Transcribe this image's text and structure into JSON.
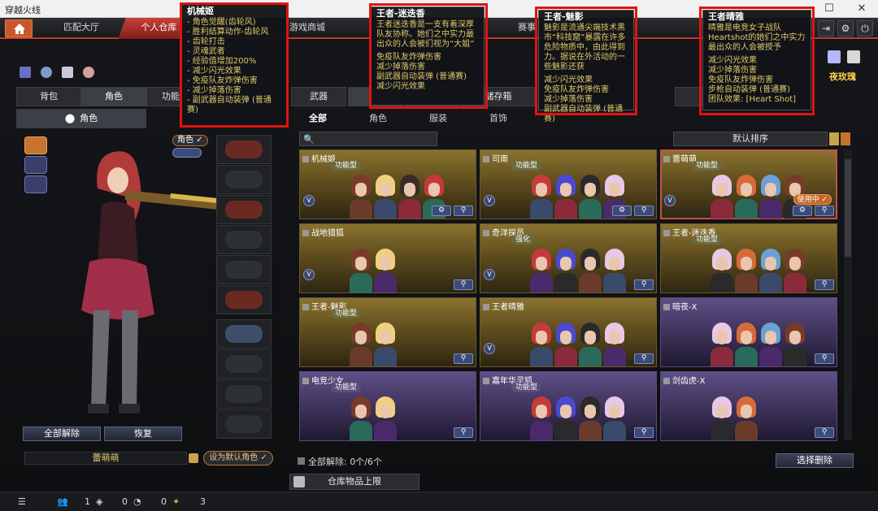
{
  "window": {
    "title": "穿越火线"
  },
  "nav": {
    "tabs": [
      "匹配大厅",
      "个人仓库",
      "游戏商城",
      "赛事"
    ],
    "active": "个人仓库"
  },
  "left": {
    "tabs": [
      "背包",
      "角色",
      "功能"
    ],
    "subtab": "角色",
    "role_badge": "角色 ✓",
    "buttons": {
      "unequip_all": "全部解除",
      "restore": "恢复"
    },
    "char_name": "蕾萌萌",
    "set_default": "设为默认角色 ✓"
  },
  "right": {
    "tabs": [
      "武器",
      "",
      "",
      "储存箱",
      ""
    ],
    "subtabs": [
      "全部",
      "角色",
      "服装",
      "首饰"
    ],
    "search_placeholder": "",
    "sort_label": "默认排序",
    "footer": {
      "unequip_count": "全部解除: 0个/6个",
      "select_delete": "选择删除",
      "storage_limit": "仓库物品上限"
    }
  },
  "cards": [
    {
      "title": "机械姬",
      "badge": "功能型",
      "style": "gold"
    },
    {
      "title": "司南",
      "badge": "功能型",
      "style": "gold"
    },
    {
      "title": "蕾萌萌",
      "badge": "功能型",
      "style": "gold",
      "in_use": "使用中 ✓"
    },
    {
      "title": "战地猎狐",
      "badge": "",
      "style": "gold"
    },
    {
      "title": "奇洋探员",
      "badge": "强化",
      "style": "gold"
    },
    {
      "title": "王者-迷迭香",
      "badge": "功能型",
      "style": "gold"
    },
    {
      "title": "王者-魅影",
      "badge": "功能型",
      "style": "gold"
    },
    {
      "title": "王者晴雅",
      "badge": "",
      "style": "gold"
    },
    {
      "title": "暗夜-X",
      "badge": "",
      "style": "purple"
    },
    {
      "title": "电竞少女",
      "badge": "功能型",
      "style": "purple"
    },
    {
      "title": "嘉年华灵狐",
      "badge": "功能型",
      "style": "purple"
    },
    {
      "title": "剑齿虎-X",
      "badge": "",
      "style": "purple"
    }
  ],
  "popups": {
    "p1": {
      "title": "机械姬",
      "lines": [
        "- 角色觉醒(齿轮风)",
        "- 胜利结算动作-齿轮风",
        "- 齿轮打击",
        "- 灵魂武者",
        "- 经验值增加200%",
        "- 减少闪光效果",
        "- 免疫队友炸弹伤害",
        "- 减少掉落伤害",
        "- 副武器自动装弹 (普通赛)"
      ]
    },
    "p2": {
      "title": "王者-迷迭香",
      "desc": "王者迷迭香是一支有着深厚队友协称。她们之中实力最出众的人会被们视为“大姐”",
      "lines": [
        "免疫队友炸弹伤害",
        "减少掉落伤害",
        "副武器自动装弹 (普通赛)",
        "减少闪光效果"
      ]
    },
    "p3": {
      "title": "王者-魅影",
      "desc": "魅影是流通尖端技术黑市“科技窟”暴露在许多危险物质中，由此得到力。据说在外活动的一些魅影还获",
      "lines": [
        "减少闪光效果",
        "免疫队友炸弹伤害",
        "减少掉落伤害",
        "副武器自动装弹 (普通赛)"
      ]
    },
    "p4": {
      "title": "王者晴雅",
      "desc": "晴雅是电竞女子战队Heartshot的她们之中实力最出众的人会被授予",
      "lines": [
        "减少闪光效果",
        "减少掉落伤害",
        "免疫队友炸弹伤害",
        "步枪自动装弹 (普通赛)",
        "团队效果: [Heart Shot]"
      ]
    }
  },
  "bottom": {
    "count1": "1",
    "count2": "0",
    "count3": "0",
    "count4": "3"
  },
  "extras": {
    "night_label": "夜玫瑰"
  }
}
